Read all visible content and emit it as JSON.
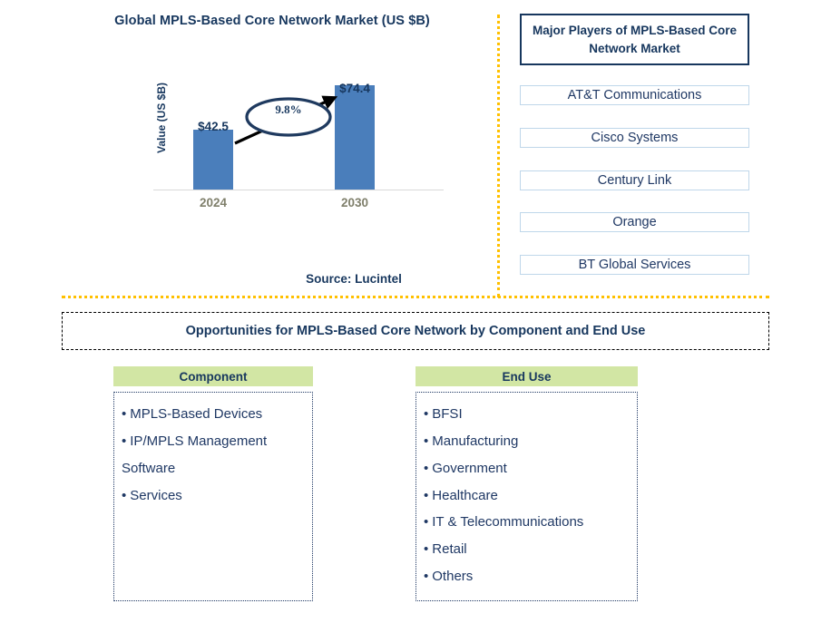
{
  "chart_panel": {
    "title": "Global MPLS-Based Core Network Market (US $B)",
    "source": "Source: Lucintel"
  },
  "chart_data": {
    "type": "bar",
    "title": "Global MPLS-Based Core Network Market (US $B)",
    "xlabel": "",
    "ylabel": "Value (US $B)",
    "categories": [
      "2024",
      "2030"
    ],
    "values": [
      42.5,
      74.4
    ],
    "value_labels": [
      "$42.5",
      "$74.4"
    ],
    "ylim": [
      0,
      80
    ],
    "grid": false,
    "legend": "none",
    "bar_color": "#4A7EBB",
    "annotations": [
      {
        "type": "cagr-ellipse",
        "text": "9.8%",
        "from_category": "2024",
        "to_category": "2030"
      }
    ]
  },
  "players_panel": {
    "header": "Major Players of MPLS-Based Core Network Market",
    "items": [
      {
        "label": "AT&T Communications"
      },
      {
        "label": "Cisco Systems"
      },
      {
        "label": "Century Link"
      },
      {
        "label": "Orange"
      },
      {
        "label": "BT Global Services"
      }
    ]
  },
  "opportunities": {
    "banner": "Opportunities for MPLS-Based Core Network by Component and End Use",
    "columns": [
      {
        "header": "Component",
        "items": [
          "MPLS-Based Devices",
          "IP/MPLS Management Software",
          "Services"
        ]
      },
      {
        "header": "End Use",
        "items": [
          "BFSI",
          "Manufacturing",
          "Government",
          "Healthcare",
          "IT & Telecommunications",
          "Retail",
          "Others"
        ]
      }
    ]
  },
  "colors": {
    "navy": "#17375E",
    "text_blue": "#1F3864",
    "bar_blue": "#4A7EBB",
    "divider_gold": "#FFC000",
    "header_green": "#D2E6A4",
    "category_gray": "#7F7F6B"
  }
}
